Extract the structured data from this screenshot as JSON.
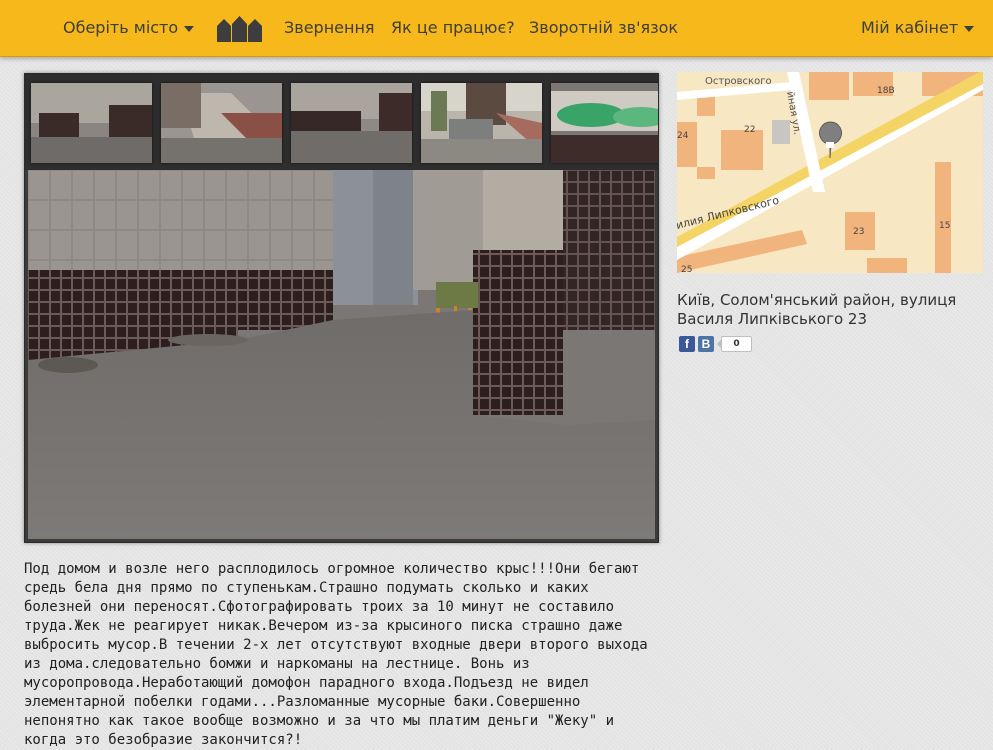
{
  "nav": {
    "city_label": "Оберіть місто",
    "appeals": "Звернення",
    "how_it_works": "Як це працює?",
    "feedback": "Зворотній зв'язок",
    "cabinet": "Мій кабінет"
  },
  "colors": {
    "nav_bg": "#f6b81a",
    "page_bg": "#e3e3e3",
    "facebook": "#3b5998",
    "vkontakte": "#4c75a3"
  },
  "map": {
    "labels": {
      "street_top": "Островского",
      "street_side": "йная ул.",
      "street_main": "илия Липковского",
      "b_18v": "18В",
      "b_22": "22",
      "b_24": "24",
      "b_23": "23",
      "b_15": "15",
      "b_25": "25"
    }
  },
  "address": "Київ, Солом'янський район, вулиця Василя Липківського 23",
  "share": {
    "fb_icon": "f",
    "vk_icon": "B",
    "count": "0"
  },
  "description": "Под домом и возле него расплодилось огромное количество крыс!!!Они бегают средь бела дня прямо по ступенькам.Страшно подумать сколько и каких болезней они переносят.Сфотографировать троих за 10 минут не составило труда.Жек не реагирует никак.Вечером из-за крысиного писка страшно даже выбросить мусор.В течении 2-х лет отсутствуют входные двери второго выхода из дома.следовательно бомжи и наркоманы на лестнице. Вонь из мусоропровода.Неработающий домофон парадного входа.Подъезд не видел элементарной побелки годами...Разломанные мусорные баки.Совершенно непонятно как такое вообще возможно и за что мы платим деньги \"Жеку\" и когда это безобразие закончится?!"
}
